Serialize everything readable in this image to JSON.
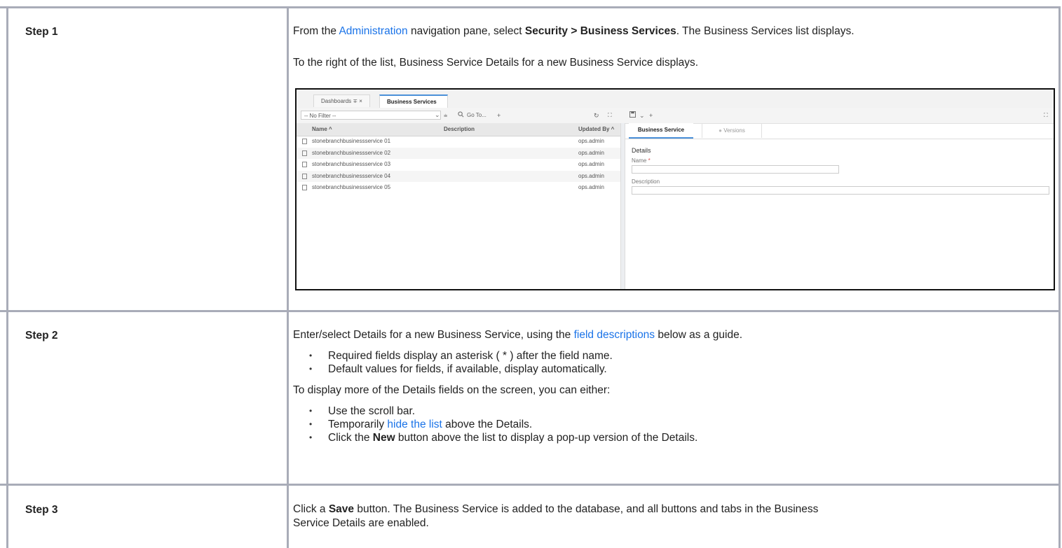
{
  "steps": [
    {
      "label": "Step 1"
    },
    {
      "label": "Step 2"
    },
    {
      "label": "Step 3"
    }
  ],
  "step1": {
    "p1_pre": "From the ",
    "p1_link": "Administration",
    "p1_mid": " navigation pane, select ",
    "p1_bold": "Security > Business Services",
    "p1_post": ". The Business Services list displays.",
    "p2": "To the right of the list, Business Service Details for a new Business Service displays."
  },
  "screenshot": {
    "tabs": [
      "Dashboards ∓ ×",
      "Business Services ×"
    ],
    "filter_value": "-- No Filter --",
    "toolbar": {
      "filter_icon": "⩧",
      "search_icon": "search-icon",
      "goto": "Go To...",
      "add": "+",
      "refresh": "↻",
      "expand": "⛶",
      "save_icon": "save-icon",
      "dropdown": "⌄",
      "detail_add": "+"
    },
    "columns": [
      "Name ^",
      "Description",
      "Updated By ^"
    ],
    "rows": [
      {
        "name": "stonebranchbusinessservice 01",
        "updated_by": "ops.admin"
      },
      {
        "name": "stonebranchbusinessservice 02",
        "updated_by": "ops.admin"
      },
      {
        "name": "stonebranchbusinessservice 03",
        "updated_by": "ops.admin"
      },
      {
        "name": "stonebranchbusinessservice 04",
        "updated_by": "ops.admin"
      },
      {
        "name": "stonebranchbusinessservice 05",
        "updated_by": "ops.admin"
      }
    ],
    "detail_tabs": [
      "Business Service",
      "Versions"
    ],
    "details_title": "Details",
    "name_label": "Name",
    "required_mark": "*",
    "description_label": "Description"
  },
  "step2": {
    "p1_pre": "Enter/select Details for a new Business Service, using the ",
    "p1_link": "field descriptions",
    "p1_post": " below as a guide.",
    "bullets1": [
      "Required fields display an asterisk ( * ) after the field name.",
      "Default values for fields, if available, display automatically."
    ],
    "p2": "To display more of the Details fields on the screen, you can either:",
    "b2_1": "Use the scroll bar.",
    "b2_2_pre": "Temporarily ",
    "b2_2_link": "hide the list",
    "b2_2_post": " above the Details.",
    "b2_3_pre": "Click the ",
    "b2_3_bold": "New",
    "b2_3_post": " button above the list to display a pop-up version of the Details."
  },
  "step3": {
    "pre": "Click a ",
    "bold": "Save",
    "post1": " button. The Business Service is added to the database, and all buttons and tabs in the Business",
    "post2": "Service Details are enabled."
  }
}
